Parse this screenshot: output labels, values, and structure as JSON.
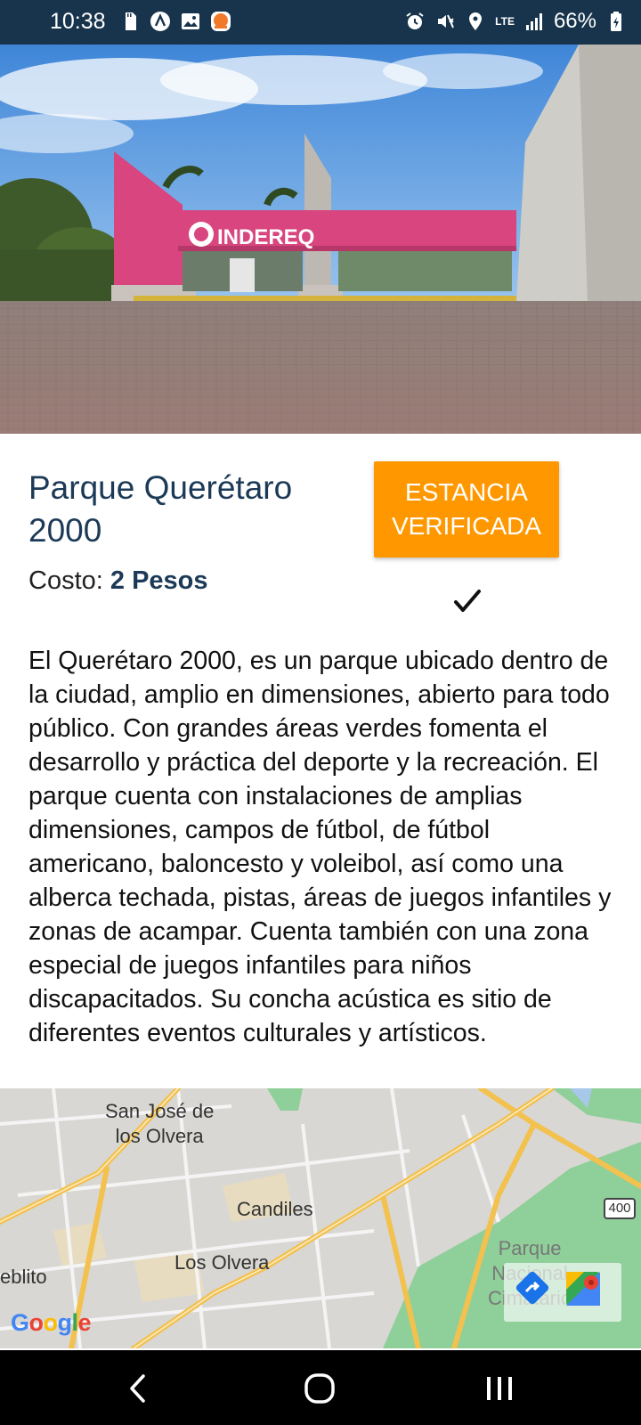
{
  "status_bar": {
    "time": "10:38",
    "network": "LTE",
    "battery": "66%"
  },
  "hero": {
    "sign_text": "INDEREQ"
  },
  "park": {
    "title": "Parque Querétaro 2000",
    "cost_label": "Costo:",
    "cost_value": "2 Pesos",
    "verified_label": "ESTANCIA VERIFICADA",
    "description": "El Querétaro 2000, es un parque ubicado dentro de la ciudad, amplio en dimensiones, abierto para todo público. Con grandes áreas verdes fomenta el desarrollo y práctica del deporte y la recreación. El parque cuenta con instalaciones de amplias dimensiones, campos de fútbol, de fútbol americano, baloncesto y voleibol, así como una alberca techada, pistas, áreas de juegos infantiles y zonas de acampar. Cuenta también con una zona especial de juegos infantiles para niños discapacitados. Su concha acústica es sitio de diferentes eventos culturales y artísticos."
  },
  "map": {
    "labels": {
      "san_jose_line1": "San José de",
      "san_jose_line2": "los Olvera",
      "candiles": "Candiles",
      "los_olvera": "Los Olvera",
      "pueblito": "eblito",
      "parque_line1": "Parque",
      "parque_line2": "Nacional",
      "parque_line3": "Cimatario",
      "highway": "400"
    },
    "google_logo": "Google",
    "colors": {
      "road": "#f2c14e",
      "green": "#8fcf9a",
      "water": "#a8c8ea"
    }
  },
  "colors": {
    "status_bar": "#17344c",
    "title": "#1c3a57",
    "accent": "#ff9800",
    "sign_pink": "#d8457f"
  }
}
